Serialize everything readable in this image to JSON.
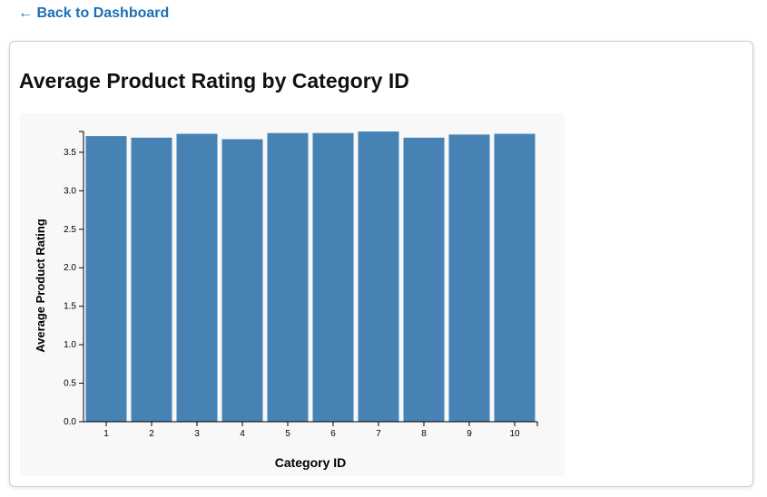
{
  "nav": {
    "back_label": "← Back to Dashboard"
  },
  "colors": {
    "bar": "#4682b4",
    "link": "#1a6fb5",
    "chart_bg": "#f8f8f8"
  },
  "chart_data": {
    "type": "bar",
    "title": "Average Product Rating by Category ID",
    "xlabel": "Category ID",
    "ylabel": "Average Product Rating",
    "categories": [
      "1",
      "2",
      "3",
      "4",
      "5",
      "6",
      "7",
      "8",
      "9",
      "10"
    ],
    "values": [
      3.71,
      3.69,
      3.74,
      3.67,
      3.75,
      3.75,
      3.77,
      3.69,
      3.73,
      3.74
    ],
    "ylim": [
      0,
      3.77
    ],
    "yticks": [
      "0.0",
      "0.5",
      "1.0",
      "1.5",
      "2.0",
      "2.5",
      "3.0",
      "3.5"
    ],
    "grid": false
  }
}
